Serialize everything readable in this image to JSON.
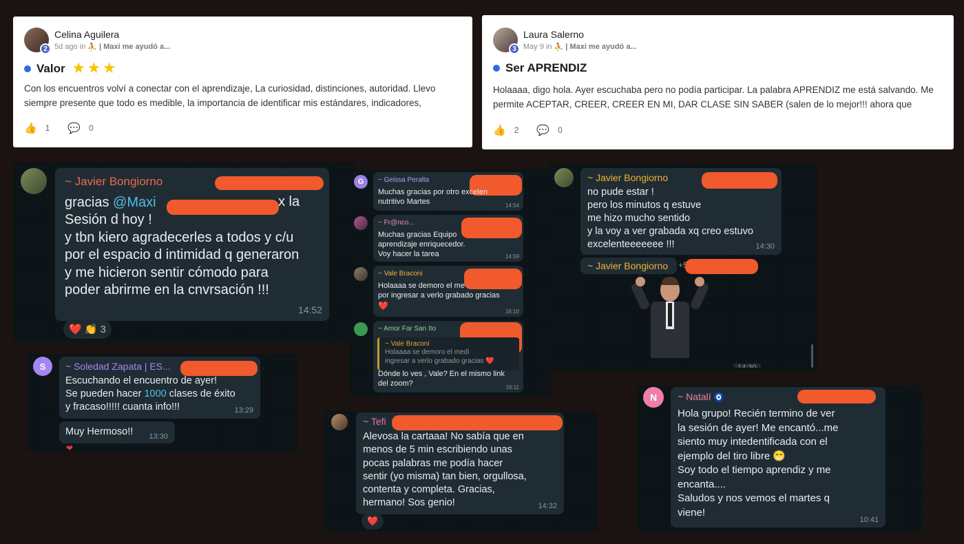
{
  "posts": [
    {
      "author": "Celina Aguilera",
      "level": "2",
      "time": "5d ago in",
      "group": "| Maxi me ayudó a...",
      "title": "Valor",
      "stars": "★ ★ ★",
      "body": "Con los encuentros volví a conectar con el aprendizaje, La curiosidad, distinciones, autoridad. Llevo siempre presente que todo es medible, la importancia de identificar mis estándares, indicadores,",
      "likes": "1",
      "comments": "0"
    },
    {
      "author": "Laura Salerno",
      "level": "3",
      "time": "May 9 in",
      "group": "| Maxi me ayudó a...",
      "title": "Ser APRENDIZ",
      "body": "Holaaaa, digo hola. Ayer escuchaba pero no podía participar. La palabra APRENDIZ me está salvando. Me permite ACEPTAR, CREER, CREER EN MI, DAR CLASE SIN SABER (salen de lo mejor!!! ahora que",
      "likes": "2",
      "comments": "0"
    }
  ],
  "chat1": {
    "name": "~ Javier Bongiorno",
    "pre": "gracias ",
    "mention": "@Maxi",
    "post": "x la",
    "text": "Sesión d hoy !\ny tbn kiero agradecerles a todos y c/u\npor el espacio d intimidad q generaron\ny me hicieron sentir cómodo para\npoder abrirme en la cnvrsación  !!!",
    "time": "14:52",
    "reactions": "❤️ 👏",
    "reaction_count": "3"
  },
  "chat2": [
    {
      "name": "~ Geissa Peralta",
      "avatar": "G",
      "text": "Muchas gracias por otro excelen\nnutritivo Martes",
      "time": "14:54",
      "color": "#b39df6"
    },
    {
      "name": "~ Fr@nco...",
      "text": "Muchas gracias  Equipo\naprendizaje enriquecedor.\nVoy hacer la tarea",
      "time": "14:59",
      "color": "#ef8fbf"
    },
    {
      "name": "~ Vale Braconi",
      "text": "Holaaaa se demoro el me\npor ingresar a verlo grabado gracias",
      "heart": "❤️",
      "time": "16:10",
      "color": "#f2b13a"
    },
    {
      "name": "~ Amor Far San Ito",
      "quote_name": "~ Vale Braconi",
      "quote_text": "Holaaaa se demoro el medi\ningresar a verlo grabado gracias ❤️",
      "text": "Dónde lo ves , Vale? En el mismo link\ndel zoom?",
      "time": "16:11",
      "color": "#8bd38f"
    }
  ],
  "chat3": {
    "name": "~ Javier Bongiorno",
    "text": "no pude estar !\npero los minutos q estuve\nme hizo mucho sentido\ny la voy a ver grabada xq creo estuvo\nexcelenteeeeeee !!!",
    "time": "14:30",
    "name2": "~ Javier Bongiorno",
    "num2": "+5",
    "time2": "14:30"
  },
  "chat4": {
    "name": "~ Soledad Zapata | ES...",
    "avatar": "S",
    "pre": "Escuchando el encuentro de ayer!\nSe pueden hacer ",
    "highlight": "1000",
    "post": " clases de éxito\ny fracaso!!!!! cuanta info!!!",
    "time": "13:29",
    "text2": "Muy Hermoso!!",
    "time2": "13:30"
  },
  "chat5": {
    "name": "~ Tefi",
    "text": "Alevosa la cartaaa! No sabía que en\nmenos de 5 min escribiendo unas\npocas palabras me podía hacer\nsentir (yo misma) tan bien, orgullosa,\ncontenta y completa. Gracias,\nhermano! Sos genio!",
    "time": "14:32",
    "reaction": "❤️"
  },
  "chat6": {
    "name": "~ Natalí",
    "avatar": "N",
    "text": "Hola grupo! Recién termino de ver\nla sesión de ayer! Me encantó...me\nsiento muy intedentificada con el\nejemplo del tiro libre 😁\nSoy todo el tiempo aprendiz y me\nencanta....\nSaludos y nos vemos el martes q\nviene!",
    "time": "10:41"
  }
}
